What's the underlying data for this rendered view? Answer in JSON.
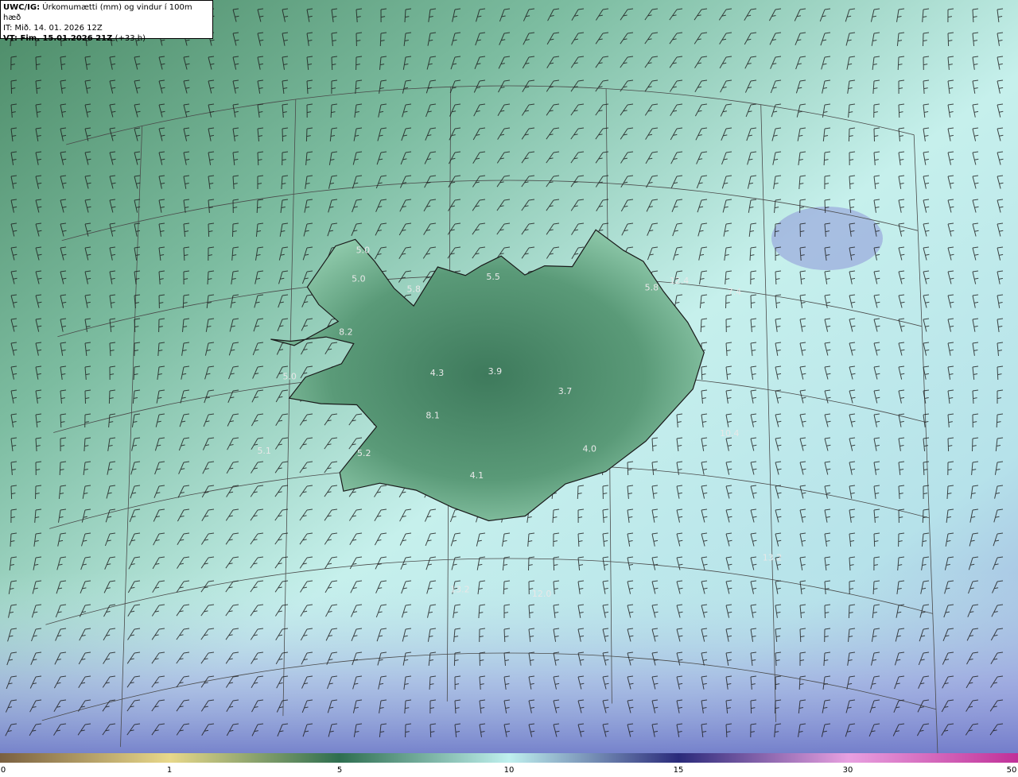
{
  "header": {
    "model": "UWC/IG:",
    "field": "Úrkomumætti (mm) og vindur í 100m hæð",
    "init_time": "IT: Mið. 14. 01. 2026 12Z",
    "valid_label": "VT: Fim. 15.01.2026 21Z",
    "valid_offset": "(+33 h)"
  },
  "labels": [
    {
      "text": "5.0",
      "lon": -22.2,
      "lat": 66.3
    },
    {
      "text": "5.0",
      "lon": -22.3,
      "lat": 66.0
    },
    {
      "text": "5.8",
      "lon": -20.9,
      "lat": 65.85
    },
    {
      "text": "5.5",
      "lon": -18.9,
      "lat": 65.95
    },
    {
      "text": "5.8",
      "lon": -14.9,
      "lat": 65.9
    },
    {
      "text": "12.4",
      "lon": -14.2,
      "lat": 66.0
    },
    {
      "text": "7.4",
      "lon": -12.8,
      "lat": 65.95
    },
    {
      "text": "8.2",
      "lon": -22.6,
      "lat": 65.45
    },
    {
      "text": "5.0",
      "lon": -24.0,
      "lat": 65.05
    },
    {
      "text": "4.3",
      "lon": -20.3,
      "lat": 64.95
    },
    {
      "text": "3.9",
      "lon": -18.85,
      "lat": 64.95
    },
    {
      "text": "3.7",
      "lon": -17.1,
      "lat": 64.75
    },
    {
      "text": "10.4",
      "lon": -13.0,
      "lat": 64.45
    },
    {
      "text": "8.1",
      "lon": -20.4,
      "lat": 64.5
    },
    {
      "text": "5.1",
      "lon": -24.6,
      "lat": 64.3
    },
    {
      "text": "5.2",
      "lon": -22.1,
      "lat": 64.15
    },
    {
      "text": "4.0",
      "lon": -16.5,
      "lat": 64.15
    },
    {
      "text": "4.1",
      "lon": -19.3,
      "lat": 63.85
    },
    {
      "text": "13.2",
      "lon": -12.0,
      "lat": 63.2
    },
    {
      "text": "13.2",
      "lon": -19.7,
      "lat": 62.65
    },
    {
      "text": "12.0",
      "lon": -17.7,
      "lat": 62.6
    }
  ],
  "colorbar": {
    "ticks": [
      "0",
      "1",
      "5",
      "10",
      "15",
      "30",
      "50"
    ],
    "colors": [
      "#7a6040",
      "#e8d88a",
      "#2e6e50",
      "#bff0ee",
      "#2a2a7a",
      "#e8a0e0",
      "#c03098"
    ]
  },
  "colors": {
    "land_dark": "#3e7a5c",
    "land_light": "#8ec8a4",
    "sea_light": "#c6f0ec",
    "sea_blue": "#8e96d8",
    "coast": "#1a1a1a",
    "grid": "#4a4a4a"
  },
  "projection": {
    "lon0": -18.5,
    "lat0": 65.0,
    "km_per_deg_lat": 111.2
  }
}
